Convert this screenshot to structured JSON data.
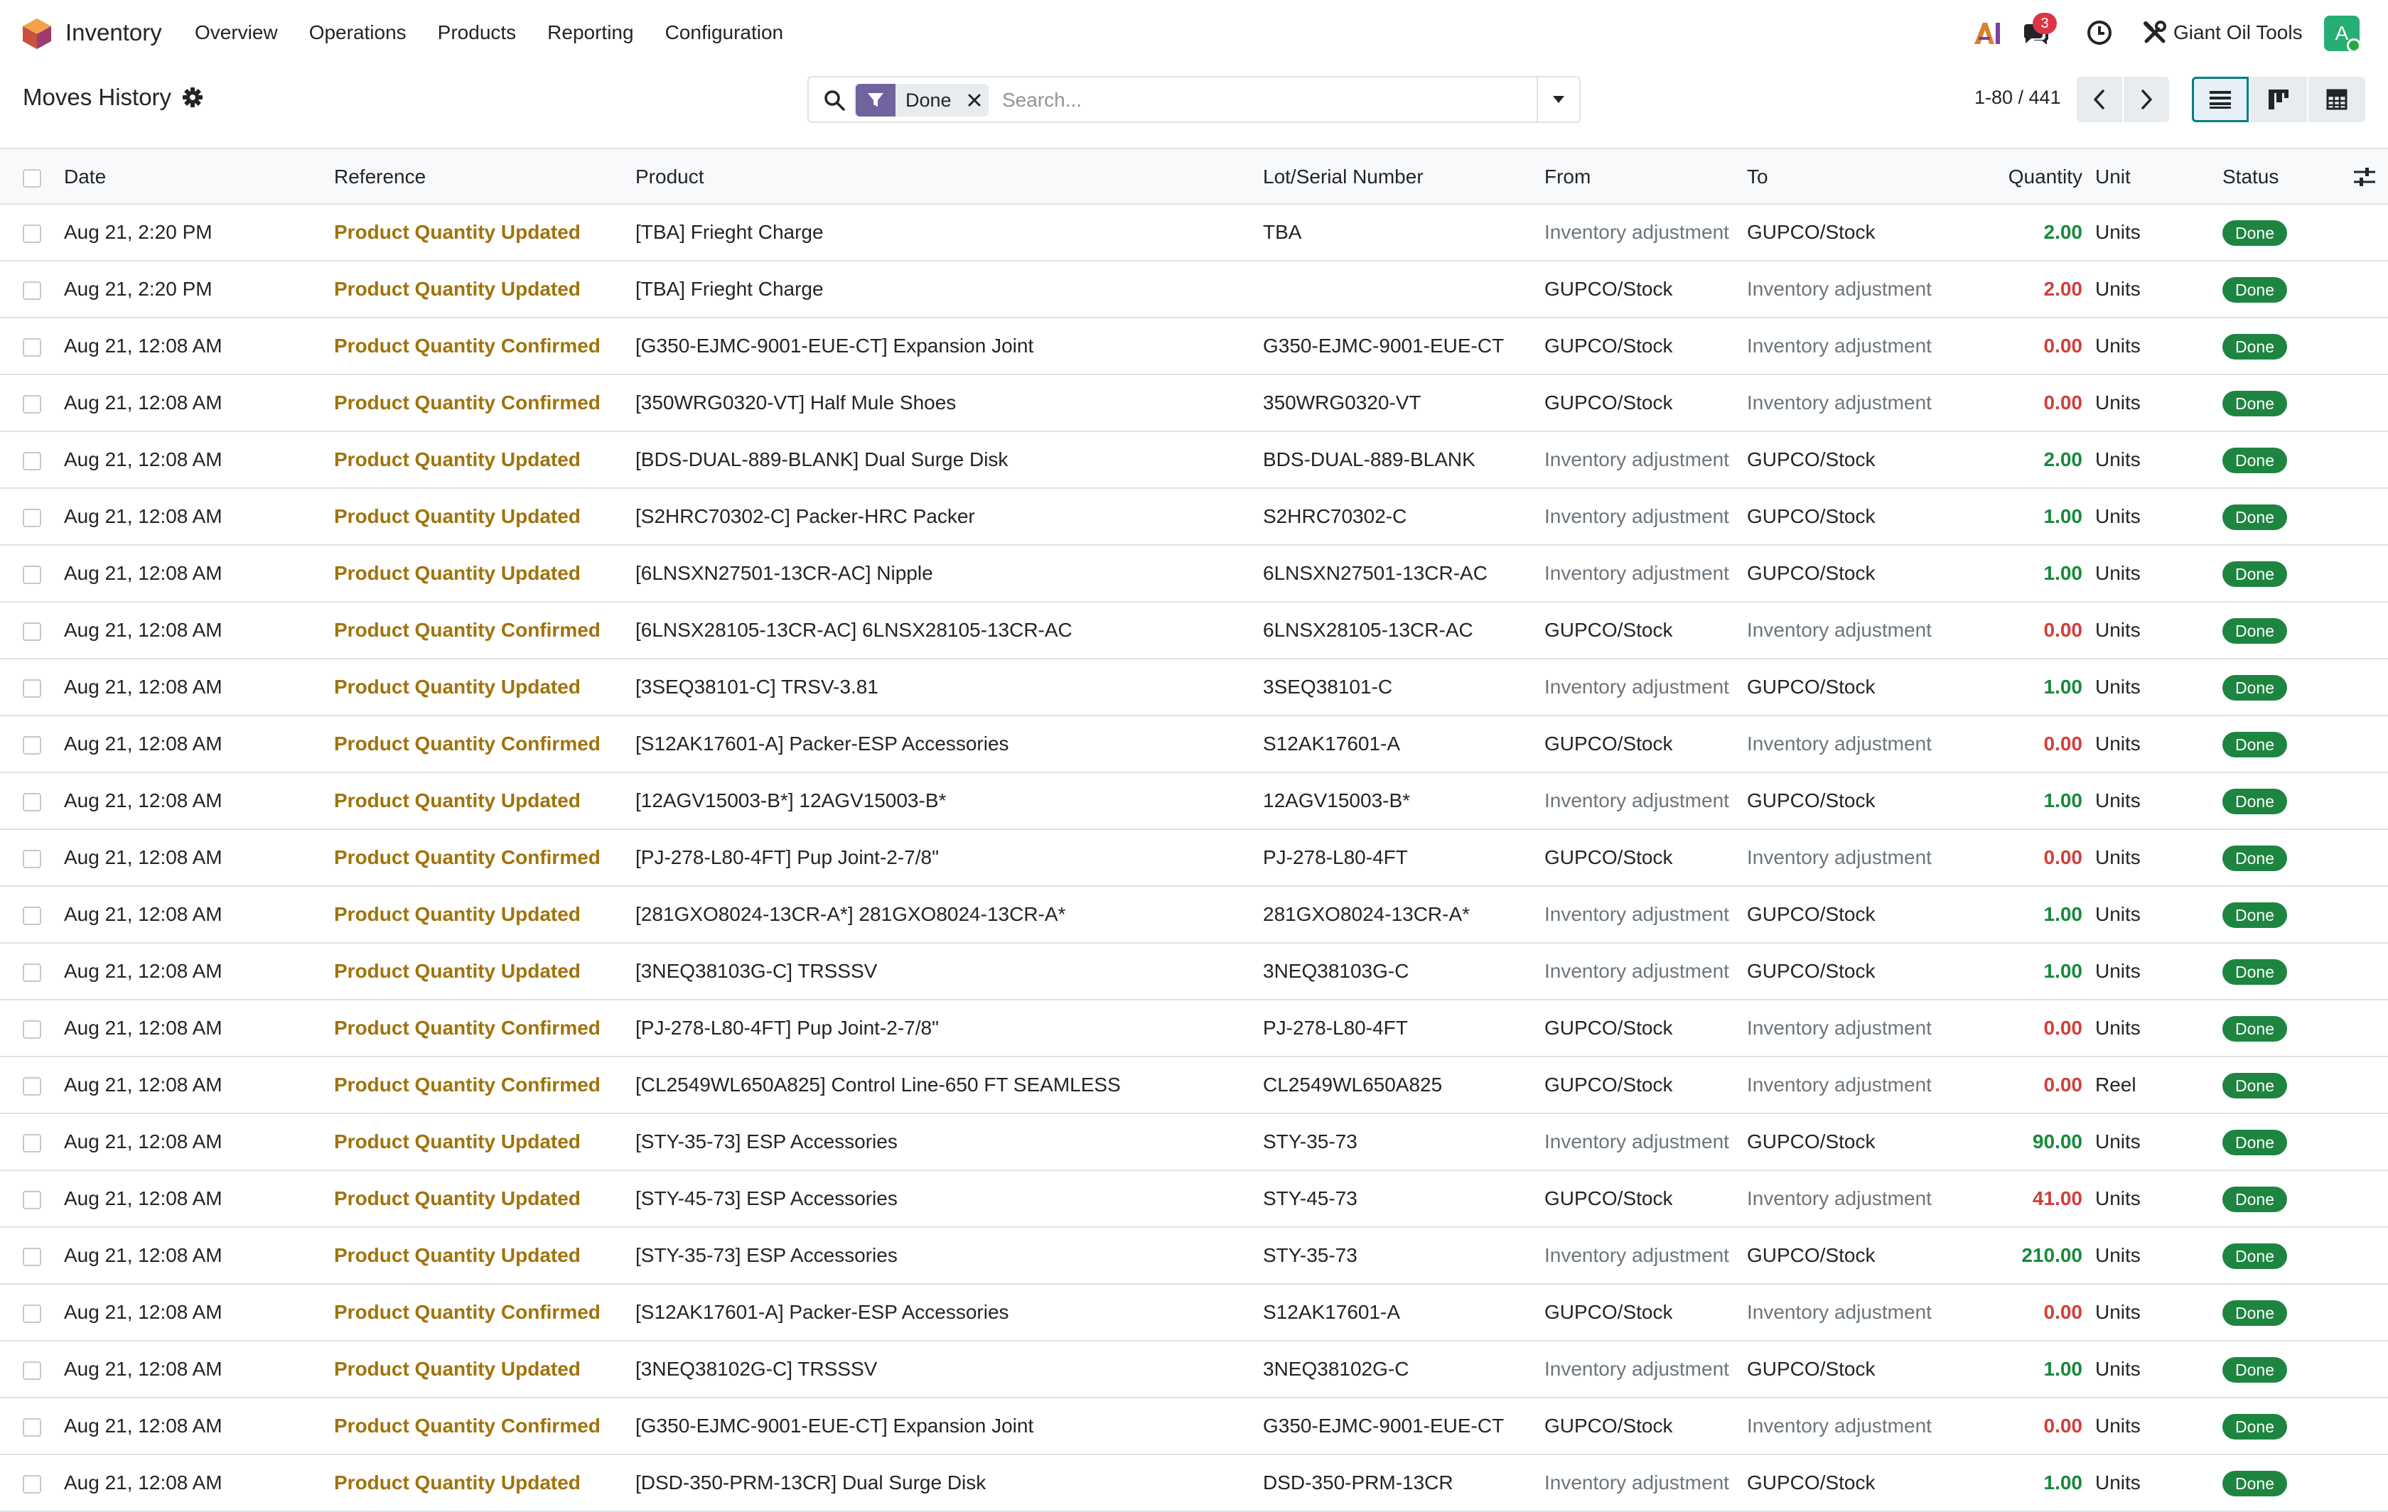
{
  "app": {
    "name": "Inventory"
  },
  "menu": [
    "Overview",
    "Operations",
    "Products",
    "Reporting",
    "Configuration"
  ],
  "nav": {
    "messages_badge": "3",
    "company": "Giant Oil Tools",
    "avatar_letter": "A"
  },
  "page": {
    "title": "Moves History"
  },
  "search": {
    "facet": "Done",
    "placeholder": "Search..."
  },
  "pager": {
    "value": "1-80 / 441"
  },
  "table": {
    "headers": {
      "date": "Date",
      "reference": "Reference",
      "product": "Product",
      "lot": "Lot/Serial Number",
      "from": "From",
      "to": "To",
      "quantity": "Quantity",
      "unit": "Unit",
      "status": "Status"
    },
    "rows": [
      {
        "date": "Aug 21, 2:20 PM",
        "reference": "Product Quantity Updated",
        "product": "[TBA] Frieght Charge",
        "lot": "TBA",
        "from": "Inventory adjustment",
        "to": "GUPCO/Stock",
        "quantity": "2.00",
        "sign": "pos",
        "unit": "Units",
        "status": "Done"
      },
      {
        "date": "Aug 21, 2:20 PM",
        "reference": "Product Quantity Updated",
        "product": "[TBA] Frieght Charge",
        "lot": "",
        "from": "GUPCO/Stock",
        "to": "Inventory adjustment",
        "quantity": "2.00",
        "sign": "neg",
        "unit": "Units",
        "status": "Done"
      },
      {
        "date": "Aug 21, 12:08 AM",
        "reference": "Product Quantity Confirmed",
        "product": "[G350-EJMC-9001-EUE-CT] Expansion Joint",
        "lot": "G350-EJMC-9001-EUE-CT",
        "from": "GUPCO/Stock",
        "to": "Inventory adjustment",
        "quantity": "0.00",
        "sign": "neg",
        "unit": "Units",
        "status": "Done"
      },
      {
        "date": "Aug 21, 12:08 AM",
        "reference": "Product Quantity Confirmed",
        "product": "[350WRG0320-VT] Half Mule Shoes",
        "lot": "350WRG0320-VT",
        "from": "GUPCO/Stock",
        "to": "Inventory adjustment",
        "quantity": "0.00",
        "sign": "neg",
        "unit": "Units",
        "status": "Done"
      },
      {
        "date": "Aug 21, 12:08 AM",
        "reference": "Product Quantity Updated",
        "product": "[BDS-DUAL-889-BLANK] Dual Surge Disk",
        "lot": "BDS-DUAL-889-BLANK",
        "from": "Inventory adjustment",
        "to": "GUPCO/Stock",
        "quantity": "2.00",
        "sign": "pos",
        "unit": "Units",
        "status": "Done"
      },
      {
        "date": "Aug 21, 12:08 AM",
        "reference": "Product Quantity Updated",
        "product": "[S2HRC70302-C] Packer-HRC Packer",
        "lot": "S2HRC70302-C",
        "from": "Inventory adjustment",
        "to": "GUPCO/Stock",
        "quantity": "1.00",
        "sign": "pos",
        "unit": "Units",
        "status": "Done"
      },
      {
        "date": "Aug 21, 12:08 AM",
        "reference": "Product Quantity Updated",
        "product": "[6LNSXN27501-13CR-AC] Nipple",
        "lot": "6LNSXN27501-13CR-AC",
        "from": "Inventory adjustment",
        "to": "GUPCO/Stock",
        "quantity": "1.00",
        "sign": "pos",
        "unit": "Units",
        "status": "Done"
      },
      {
        "date": "Aug 21, 12:08 AM",
        "reference": "Product Quantity Confirmed",
        "product": "[6LNSX28105-13CR-AC] 6LNSX28105-13CR-AC",
        "lot": "6LNSX28105-13CR-AC",
        "from": "GUPCO/Stock",
        "to": "Inventory adjustment",
        "quantity": "0.00",
        "sign": "neg",
        "unit": "Units",
        "status": "Done"
      },
      {
        "date": "Aug 21, 12:08 AM",
        "reference": "Product Quantity Updated",
        "product": "[3SEQ38101-C] TRSV-3.81",
        "lot": "3SEQ38101-C",
        "from": "Inventory adjustment",
        "to": "GUPCO/Stock",
        "quantity": "1.00",
        "sign": "pos",
        "unit": "Units",
        "status": "Done"
      },
      {
        "date": "Aug 21, 12:08 AM",
        "reference": "Product Quantity Confirmed",
        "product": "[S12AK17601-A] Packer-ESP Accessories",
        "lot": "S12AK17601-A",
        "from": "GUPCO/Stock",
        "to": "Inventory adjustment",
        "quantity": "0.00",
        "sign": "neg",
        "unit": "Units",
        "status": "Done"
      },
      {
        "date": "Aug 21, 12:08 AM",
        "reference": "Product Quantity Updated",
        "product": "[12AGV15003-B*] 12AGV15003-B*",
        "lot": "12AGV15003-B*",
        "from": "Inventory adjustment",
        "to": "GUPCO/Stock",
        "quantity": "1.00",
        "sign": "pos",
        "unit": "Units",
        "status": "Done"
      },
      {
        "date": "Aug 21, 12:08 AM",
        "reference": "Product Quantity Confirmed",
        "product": "[PJ-278-L80-4FT] Pup Joint-2-7/8\"",
        "lot": "PJ-278-L80-4FT",
        "from": "GUPCO/Stock",
        "to": "Inventory adjustment",
        "quantity": "0.00",
        "sign": "neg",
        "unit": "Units",
        "status": "Done"
      },
      {
        "date": "Aug 21, 12:08 AM",
        "reference": "Product Quantity Updated",
        "product": "[281GXO8024-13CR-A*] 281GXO8024-13CR-A*",
        "lot": "281GXO8024-13CR-A*",
        "from": "Inventory adjustment",
        "to": "GUPCO/Stock",
        "quantity": "1.00",
        "sign": "pos",
        "unit": "Units",
        "status": "Done"
      },
      {
        "date": "Aug 21, 12:08 AM",
        "reference": "Product Quantity Updated",
        "product": "[3NEQ38103G-C] TRSSSV",
        "lot": "3NEQ38103G-C",
        "from": "Inventory adjustment",
        "to": "GUPCO/Stock",
        "quantity": "1.00",
        "sign": "pos",
        "unit": "Units",
        "status": "Done"
      },
      {
        "date": "Aug 21, 12:08 AM",
        "reference": "Product Quantity Confirmed",
        "product": "[PJ-278-L80-4FT] Pup Joint-2-7/8\"",
        "lot": "PJ-278-L80-4FT",
        "from": "GUPCO/Stock",
        "to": "Inventory adjustment",
        "quantity": "0.00",
        "sign": "neg",
        "unit": "Units",
        "status": "Done"
      },
      {
        "date": "Aug 21, 12:08 AM",
        "reference": "Product Quantity Confirmed",
        "product": "[CL2549WL650A825] Control Line-650 FT SEAMLESS",
        "lot": "CL2549WL650A825",
        "from": "GUPCO/Stock",
        "to": "Inventory adjustment",
        "quantity": "0.00",
        "sign": "neg",
        "unit": "Reel",
        "status": "Done"
      },
      {
        "date": "Aug 21, 12:08 AM",
        "reference": "Product Quantity Updated",
        "product": "[STY-35-73] ESP Accessories",
        "lot": "STY-35-73",
        "from": "Inventory adjustment",
        "to": "GUPCO/Stock",
        "quantity": "90.00",
        "sign": "pos",
        "unit": "Units",
        "status": "Done"
      },
      {
        "date": "Aug 21, 12:08 AM",
        "reference": "Product Quantity Updated",
        "product": "[STY-45-73] ESP Accessories",
        "lot": "STY-45-73",
        "from": "GUPCO/Stock",
        "to": "Inventory adjustment",
        "quantity": "41.00",
        "sign": "neg",
        "unit": "Units",
        "status": "Done"
      },
      {
        "date": "Aug 21, 12:08 AM",
        "reference": "Product Quantity Updated",
        "product": "[STY-35-73] ESP Accessories",
        "lot": "STY-35-73",
        "from": "Inventory adjustment",
        "to": "GUPCO/Stock",
        "quantity": "210.00",
        "sign": "pos",
        "unit": "Units",
        "status": "Done"
      },
      {
        "date": "Aug 21, 12:08 AM",
        "reference": "Product Quantity Confirmed",
        "product": "[S12AK17601-A] Packer-ESP Accessories",
        "lot": "S12AK17601-A",
        "from": "GUPCO/Stock",
        "to": "Inventory adjustment",
        "quantity": "0.00",
        "sign": "neg",
        "unit": "Units",
        "status": "Done"
      },
      {
        "date": "Aug 21, 12:08 AM",
        "reference": "Product Quantity Updated",
        "product": "[3NEQ38102G-C] TRSSSV",
        "lot": "3NEQ38102G-C",
        "from": "Inventory adjustment",
        "to": "GUPCO/Stock",
        "quantity": "1.00",
        "sign": "pos",
        "unit": "Units",
        "status": "Done"
      },
      {
        "date": "Aug 21, 12:08 AM",
        "reference": "Product Quantity Confirmed",
        "product": "[G350-EJMC-9001-EUE-CT] Expansion Joint",
        "lot": "G350-EJMC-9001-EUE-CT",
        "from": "GUPCO/Stock",
        "to": "Inventory adjustment",
        "quantity": "0.00",
        "sign": "neg",
        "unit": "Units",
        "status": "Done"
      },
      {
        "date": "Aug 21, 12:08 AM",
        "reference": "Product Quantity Updated",
        "product": "[DSD-350-PRM-13CR] Dual Surge Disk",
        "lot": "DSD-350-PRM-13CR",
        "from": "Inventory adjustment",
        "to": "GUPCO/Stock",
        "quantity": "1.00",
        "sign": "pos",
        "unit": "Units",
        "status": "Done"
      }
    ]
  }
}
